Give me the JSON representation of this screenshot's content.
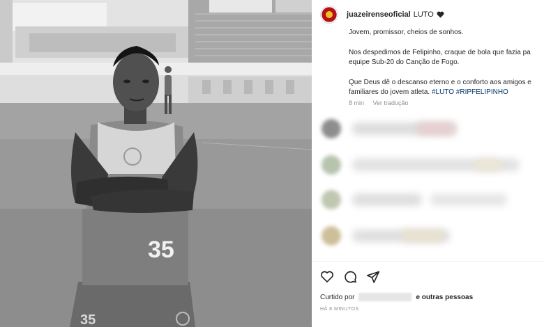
{
  "post": {
    "username": "juazeirenseoficial",
    "title": "LUTO",
    "title_icon": "black-heart-icon",
    "caption": {
      "line1": "Jovem, promissor, cheios de sonhos.",
      "line2a": "Nos despedimos de Felipinho, craque de bola que fazia pa",
      "line2b": "equipe Sub-20 do Canção de Fogo.",
      "line3a": "Que Deus dê o descanso eterno e o conforto aos amigos e",
      "line3b": "familiares do jovem atleta.",
      "hashtag1": "#LUTO",
      "hashtag2": "#RIPFELIPINHO"
    },
    "meta": {
      "time": "8 min",
      "translate": "Ver tradução"
    },
    "likes": {
      "prefix": "Curtido por",
      "suffix": "e outras pessoas"
    },
    "timestamp": "HÁ 8 MINUTOS"
  },
  "photo": {
    "jersey_number": "35",
    "shorts_number": "35"
  },
  "actions": [
    {
      "name": "like-button",
      "icon": "heart-outline-icon"
    },
    {
      "name": "comment-button",
      "icon": "speech-bubble-icon"
    },
    {
      "name": "share-button",
      "icon": "paper-plane-icon"
    }
  ],
  "colors": {
    "text": "#262626",
    "muted": "#8e8e8e",
    "hashtag": "#00376b",
    "avatar_red": "#b3121b",
    "avatar_yellow": "#f1c21b"
  }
}
